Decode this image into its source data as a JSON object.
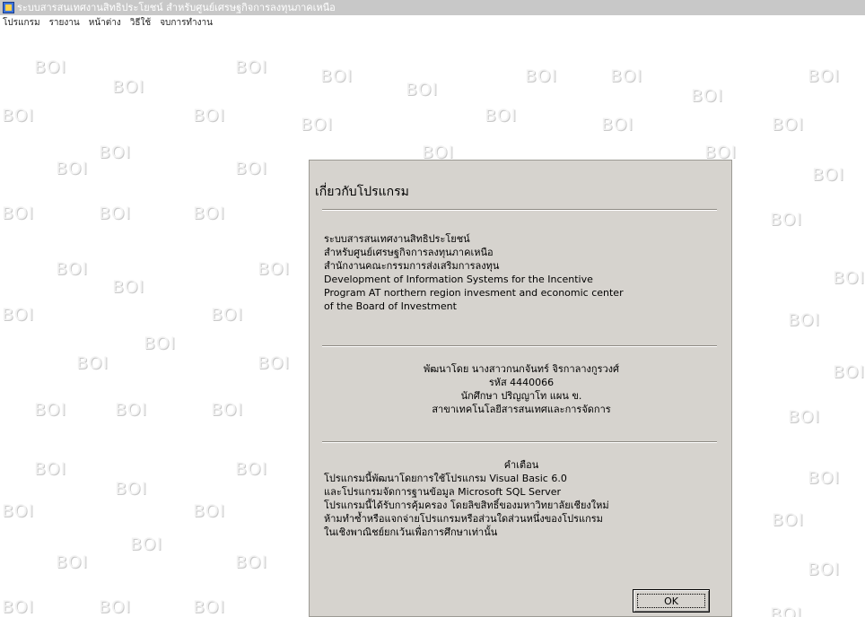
{
  "window": {
    "title": "ระบบสารสนเทศงานสิทธิประโยชน์ สำหรับศูนย์เศรษฐกิจการลงทุนภาคเหนือ"
  },
  "menu": {
    "items": [
      "โปรแกรม",
      "รายงาน",
      "หน้าต่าง",
      "วิธีใช้",
      "จบการทำงาน"
    ]
  },
  "background": {
    "watermark_text": "BOI"
  },
  "about": {
    "title": "เกี่ยวกับโปรแกรม",
    "system_lines": [
      "ระบบสารสนเทศงานสิทธิประโยชน์",
      "สำหรับศูนย์เศรษฐกิจการลงทุนภาคเหนือ",
      "สำนักงานคณะกรรมการส่งเสริมการลงทุน",
      "Development of Information Systems for the Incentive",
      "Program AT northern region invesment and economic center",
      "of the Board of Investment"
    ],
    "developer_lines": [
      "พัฒนาโดย นางสาวกนกจันทร์  จิรกาลางกูรวงศ์",
      "รหัส 4440066",
      "นักศึกษา ปริญญาโท แผน ข.",
      "สาขาเทคโนโลยีสารสนเทศและการจัดการ"
    ],
    "warning_heading": "คำเตือน",
    "warning_lines": [
      "โปรแกรมนี้พัฒนาโดยการใช้โปรแกรม Visual Basic 6.0",
      "และโปรแกรมจัดการฐานข้อมูล Microsoft SQL Server",
      "โปรแกรมนี้ได้รับการคุ้มครอง โดยลิขสิทธิ์ของมหาวิทยาลัยเชียงใหม่",
      "ห้ามทำซ้ำหรือแจกจ่ายโปรแกรมหรือส่วนใดส่วนหนึ่งของโปรแกรม",
      "ในเชิงพาณิชย์ยกเว้นเพื่อการศึกษาเท่านั้น"
    ],
    "ok_label": "OK"
  }
}
